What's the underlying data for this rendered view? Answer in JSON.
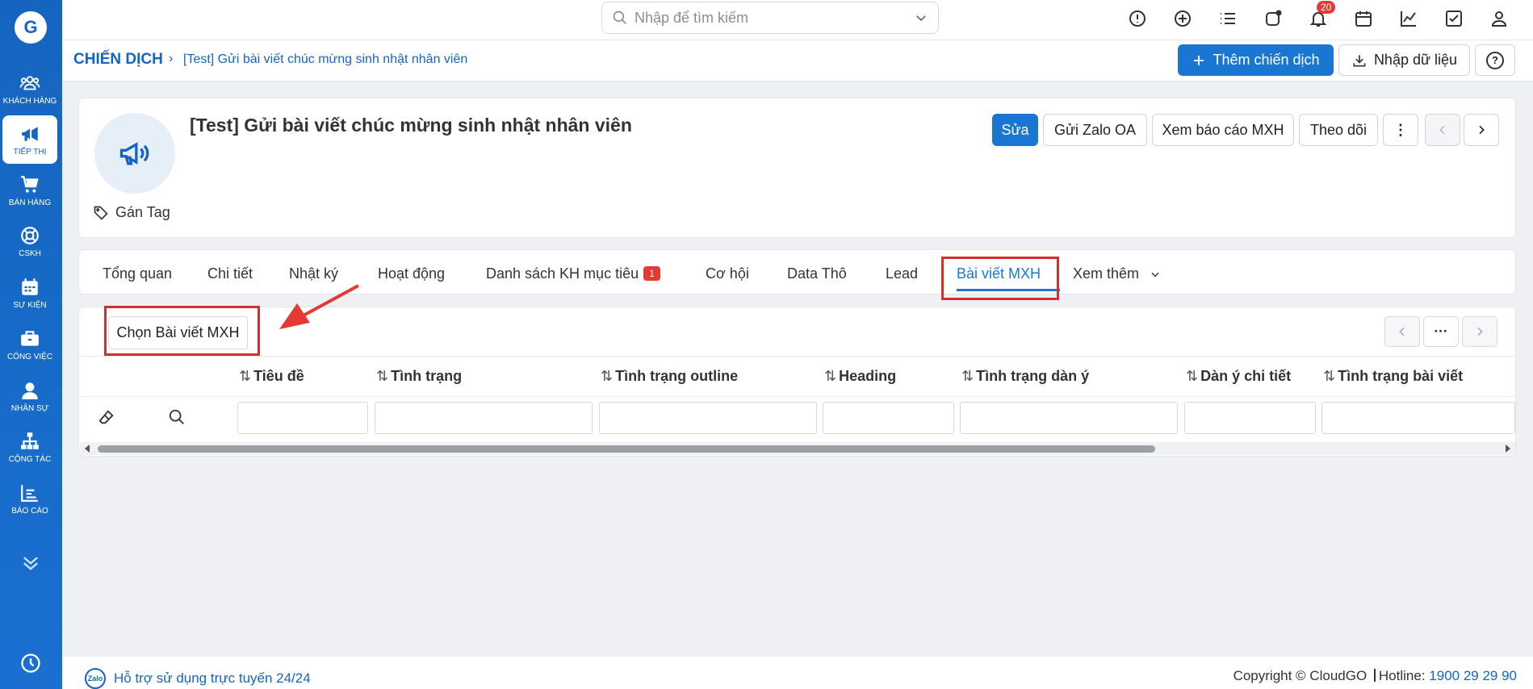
{
  "sidebar": {
    "logo_text": "G",
    "items": [
      {
        "label": "KHÁCH HÀNG",
        "icon": "users-icon"
      },
      {
        "label": "TIẾP THỊ",
        "icon": "megaphone-icon"
      },
      {
        "label": "BÁN HÀNG",
        "icon": "cart-icon"
      },
      {
        "label": "CSKH",
        "icon": "lifebuoy-icon"
      },
      {
        "label": "SỰ KIỆN",
        "icon": "calendar-icon"
      },
      {
        "label": "CÔNG VIỆC",
        "icon": "briefcase-icon"
      },
      {
        "label": "NHÂN SỰ",
        "icon": "person-icon"
      },
      {
        "label": "CỘNG TÁC",
        "icon": "org-chart-icon"
      },
      {
        "label": "BÁO CÁO",
        "icon": "report-icon"
      }
    ]
  },
  "topbar": {
    "search_placeholder": "Nhập để tìm kiếm",
    "notification_count": "20"
  },
  "breadcrumb": {
    "root": "CHIẾN DỊCH",
    "separator": "›",
    "current": "[Test] Gửi bài viết chúc mừng sinh nhật nhân viên"
  },
  "header_actions": {
    "add": "Thêm chiến dịch",
    "import": "Nhập dữ liệu",
    "help": "?"
  },
  "record": {
    "title": "[Test] Gửi bài viết chúc mừng sinh nhật nhân viên",
    "tag_label": "Gán Tag",
    "actions": {
      "edit": "Sửa",
      "send_zalo": "Gửi Zalo OA",
      "view_report": "Xem báo cáo MXH",
      "follow": "Theo dõi",
      "more": "⋮"
    }
  },
  "tabs": [
    {
      "label": "Tổng quan"
    },
    {
      "label": "Chi tiết"
    },
    {
      "label": "Nhật ký"
    },
    {
      "label": "Hoạt động"
    },
    {
      "label": "Danh sách KH mục tiêu",
      "badge": "1"
    },
    {
      "label": "Cơ hội"
    },
    {
      "label": "Data Thô"
    },
    {
      "label": "Lead"
    },
    {
      "label": "Bài viết MXH"
    },
    {
      "label": "Xem thêm"
    }
  ],
  "related": {
    "select_button": "Chọn Bài viết MXH",
    "more": "···",
    "columns": [
      "Tiêu đề",
      "Tình trạng",
      "Tình trạng outline",
      "Heading",
      "Tình trạng dàn ý",
      "Dàn ý chi tiết",
      "Tình trạng bài viết"
    ]
  },
  "footer": {
    "zalo": "Zalo",
    "support": "Hỗ trợ sử dụng trực tuyến 24/24",
    "copyright": "Copyright © CloudGO",
    "hotline_label": "Hotline:",
    "hotline": "1900 29 29 90"
  },
  "colors": {
    "primary": "#1976d2",
    "sidebar": "#1565c0",
    "highlight": "#d32f2f",
    "badge": "#e53935"
  }
}
